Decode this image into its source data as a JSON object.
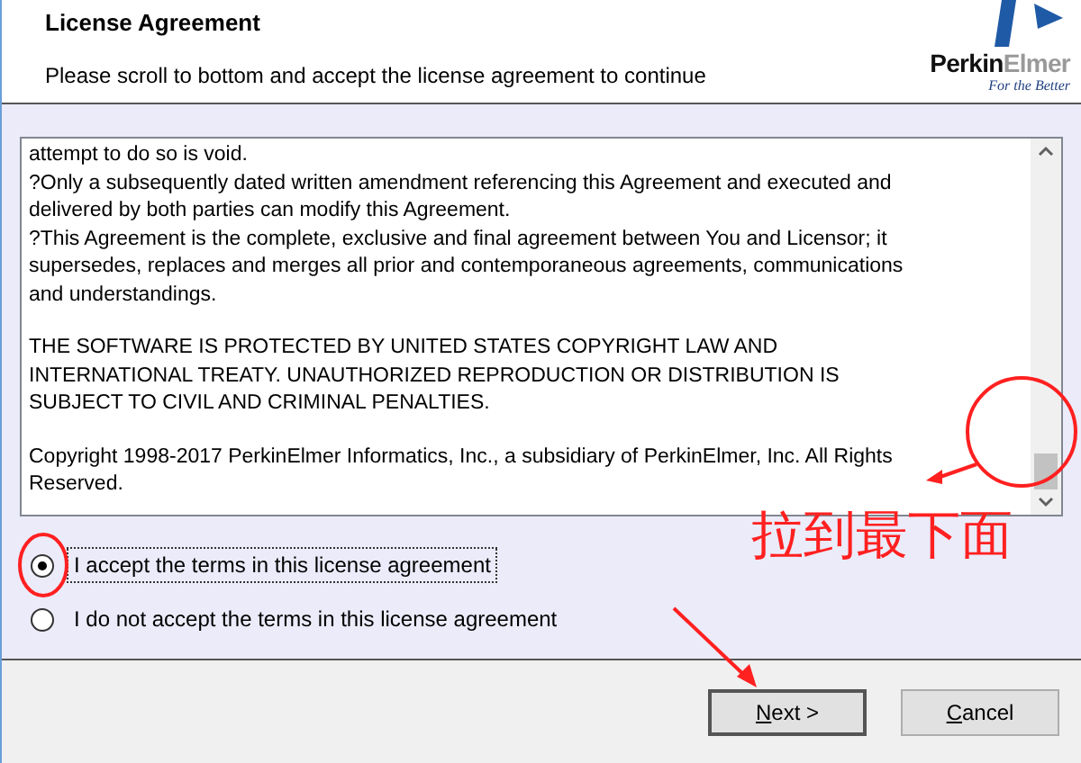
{
  "header": {
    "title": "License Agreement",
    "subtitle": "Please scroll to bottom and accept the license agreement to continue",
    "logo": {
      "word_dark": "Perkin",
      "word_light": "Elmer",
      "tagline": "For the Better"
    }
  },
  "license_text": [
    [
      "attempt to do so is void.",
      "?Only a subsequently dated written amendment referencing this Agreement and executed and delivered by both parties can modify this Agreement.",
      "?This Agreement is the complete, exclusive and final agreement between You and Licensor; it supersedes, replaces and merges all prior and contemporaneous agreements, communications and understandings."
    ],
    [
      "THE SOFTWARE IS PROTECTED BY UNITED STATES COPYRIGHT LAW AND INTERNATIONAL TREATY. UNAUTHORIZED REPRODUCTION OR DISTRIBUTION IS SUBJECT TO CIVIL AND CRIMINAL PENALTIES."
    ],
    [
      "Copyright 1998-2017 PerkinElmer Informatics, Inc., a subsidiary of PerkinElmer, Inc. All Rights Reserved."
    ]
  ],
  "options": [
    {
      "label": "I accept the terms in this license agreement",
      "selected": true
    },
    {
      "label": "I do not accept the terms in this license agreement",
      "selected": false
    }
  ],
  "buttons": [
    {
      "label": "Next >",
      "kind": "default"
    },
    {
      "label": "Cancel",
      "kind": "normal"
    }
  ],
  "annotation": {
    "note": "拉到最下面"
  }
}
